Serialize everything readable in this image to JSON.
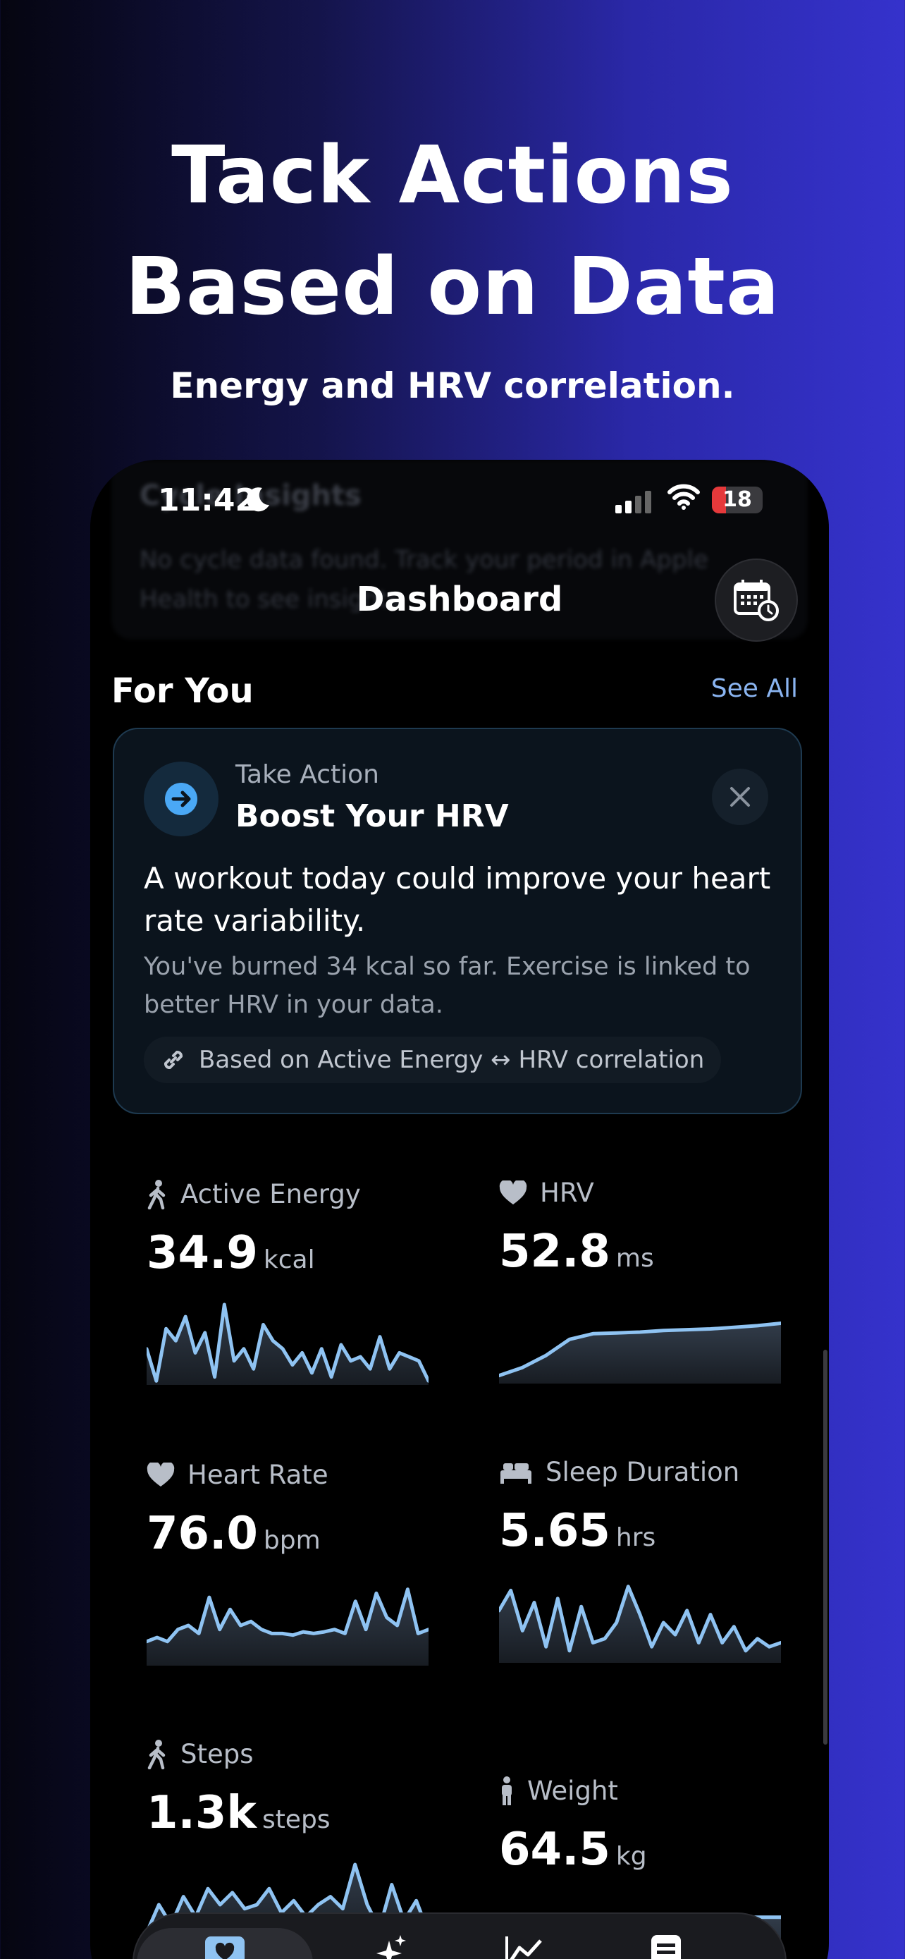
{
  "headline": {
    "line1": "Tack Actions",
    "line2": "Based on Data",
    "subtitle": "Energy and HRV correlation."
  },
  "status": {
    "time": "11:42",
    "battery": "18"
  },
  "blurred_card": {
    "title": "Cycle Insights",
    "text": "No cycle data found. Track your period in Apple Health to see insights"
  },
  "nav": {
    "title": "Dashboard"
  },
  "for_you": {
    "title": "For You",
    "see_all": "See All"
  },
  "action_card": {
    "eyebrow": "Take Action",
    "title": "Boost Your HRV",
    "body": "A workout today could improve your heart rate variability.",
    "detail": "You've burned 34 kcal so far. Exercise is linked to better HRV in your data.",
    "basis": "Based on Active Energy ↔ HRV correlation"
  },
  "metrics": [
    {
      "label": "Active Energy",
      "value": "34.9",
      "unit": "kcal",
      "icon": "walking-icon",
      "trend": [
        0.45,
        0.05,
        0.7,
        0.55,
        0.85,
        0.4,
        0.65,
        0.1,
        1.0,
        0.3,
        0.45,
        0.2,
        0.75,
        0.55,
        0.45,
        0.25,
        0.4,
        0.15,
        0.45,
        0.1,
        0.5,
        0.3,
        0.35,
        0.2,
        0.6,
        0.2,
        0.4,
        0.35,
        0.3,
        0.05
      ]
    },
    {
      "label": "HRV",
      "value": "52.8",
      "unit": "ms",
      "icon": "heart-icon",
      "trend": [
        0.1,
        0.2,
        0.35,
        0.55,
        0.62,
        0.63,
        0.64,
        0.66,
        0.67,
        0.68,
        0.7,
        0.72,
        0.75
      ]
    },
    {
      "label": "Heart Rate",
      "value": "76.0",
      "unit": "bpm",
      "icon": "heart-icon",
      "trend": [
        0.3,
        0.35,
        0.3,
        0.45,
        0.5,
        0.4,
        0.85,
        0.45,
        0.7,
        0.5,
        0.55,
        0.45,
        0.4,
        0.4,
        0.38,
        0.42,
        0.4,
        0.42,
        0.45,
        0.4,
        0.8,
        0.45,
        0.9,
        0.6,
        0.5,
        0.95,
        0.4,
        0.45
      ]
    },
    {
      "label": "Sleep Duration",
      "value": "5.65",
      "unit": "hrs",
      "icon": "bed-icon",
      "trend": [
        0.65,
        0.9,
        0.4,
        0.75,
        0.2,
        0.8,
        0.15,
        0.7,
        0.25,
        0.3,
        0.5,
        0.95,
        0.6,
        0.2,
        0.5,
        0.35,
        0.65,
        0.25,
        0.6,
        0.25,
        0.45,
        0.15,
        0.3,
        0.2,
        0.25
      ]
    },
    {
      "label": "Steps",
      "value": "1.3k",
      "unit": "steps",
      "icon": "walking-icon",
      "trend": [
        0.15,
        0.5,
        0.25,
        0.6,
        0.35,
        0.7,
        0.5,
        0.65,
        0.45,
        0.5,
        0.7,
        0.4,
        0.55,
        0.35,
        0.5,
        0.6,
        0.45,
        1.0,
        0.5,
        0.2,
        0.75,
        0.3,
        0.55,
        0.15
      ]
    },
    {
      "label": "Weight",
      "value": "64.5",
      "unit": "kg",
      "icon": "person-icon",
      "trend": [
        0.8,
        0.8,
        0.8,
        0.8,
        0.8
      ]
    }
  ],
  "colors": {
    "accent": "#8ab4f0",
    "line": "#8fc3f2",
    "icon_blue": "#4aa8f5"
  }
}
